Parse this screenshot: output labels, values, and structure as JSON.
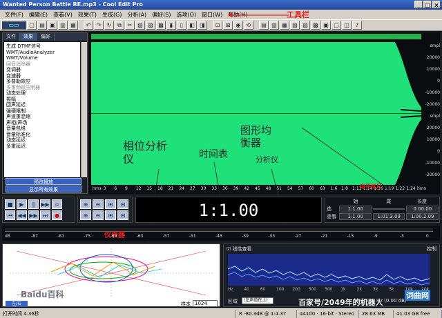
{
  "window": {
    "title": "Wanted Person Battle RE.mp3 - Cool Edit Pro",
    "controls": [
      "_",
      "□",
      "×"
    ]
  },
  "menu": {
    "items": [
      "文件(F)",
      "编辑(E)",
      "查看(V)",
      "效果(T)",
      "生成(G)",
      "分析(A)",
      "偏好(S)",
      "选项(O)",
      "窗口(W)",
      "帮助(H)"
    ],
    "annotation": "工具栏"
  },
  "left_panel": {
    "tabs": [
      "文件",
      "效果",
      "偏好"
    ],
    "active_tab": 1,
    "effects": [
      {
        "label": "生成 DTMF信号",
        "dim": false
      },
      {
        "label": "WMT/AudioAnalyzer",
        "dim": false
      },
      {
        "label": "WMT/Volume",
        "dim": false
      },
      {
        "label": "回音消除器",
        "dim": true
      },
      {
        "label": "变调器",
        "dim": false
      },
      {
        "label": "变速器",
        "dim": false
      },
      {
        "label": "多普勒效应",
        "dim": false
      },
      {
        "label": "多重频段压制器",
        "dim": true
      },
      {
        "label": "动态处理",
        "dim": false
      },
      {
        "label": "振幅",
        "dim": false
      },
      {
        "label": "回声延迟",
        "dim": false
      },
      {
        "label": "强硬限制",
        "dim": false
      },
      {
        "label": "声道重混缩",
        "dim": false
      },
      {
        "label": "声相/声场",
        "dim": false
      },
      {
        "label": "音量包络",
        "dim": false
      },
      {
        "label": "音量标准化",
        "dim": false
      },
      {
        "label": "动态延迟",
        "dim": false
      },
      {
        "label": "多重延迟",
        "dim": false
      }
    ],
    "button_1": "预览播放",
    "button_2": "显示所有效果"
  },
  "wave": {
    "scale_labels": [
      "smpl",
      "20000",
      "10000",
      "0",
      "-10000",
      "-20000",
      "smpl",
      "20000",
      "10000",
      "0",
      "-10000",
      "-20000"
    ],
    "ruler_labels": [
      "hms",
      "3",
      "6",
      "9",
      "12",
      "15",
      "18",
      "21",
      "24",
      "27",
      "30",
      "33",
      "36",
      "39",
      "42",
      "45",
      "48",
      "51",
      "54",
      "57",
      "60",
      "63",
      "1:6",
      "1:8",
      "1:11",
      "1:14",
      "1:16",
      "1:19",
      "1:22",
      "1:24",
      "hms"
    ],
    "annotation": "电平标尺"
  },
  "annotations": {
    "phase": "相位分析\n仪",
    "time": "时间表",
    "equalizer": "图形均\n衡器",
    "analyzer": "分析仪",
    "meter": "仪表器"
  },
  "transport": {
    "buttons": [
      "■",
      "▶",
      "‖",
      "▶▶",
      "∞",
      "⏮",
      "◀◀",
      "▶▶",
      "⏭",
      "●"
    ]
  },
  "zoom": {
    "buttons": [
      "⊕",
      "⊖",
      "⊞",
      "⊟",
      "⊕",
      "⊖",
      "⊞",
      "⊟"
    ]
  },
  "time_display": "1:1.00",
  "range": {
    "headers": [
      "始",
      "尾",
      "长度"
    ],
    "sel_label": "选",
    "view_label": "查看",
    "sel": [
      "1:1.00",
      "",
      "0:00.00"
    ],
    "view": [
      "1:1.00",
      "1:01.3.09",
      "1:00.2.09"
    ]
  },
  "level_meter": {
    "labels": [
      "dB",
      "-87",
      "-81",
      "-75",
      "-69",
      "-63",
      "-57",
      "-51",
      "-45",
      "-39",
      "-33",
      "-27",
      "-21",
      "-15",
      "-9",
      "-3",
      "0"
    ]
  },
  "phase": {
    "button": "左/右",
    "sample_label": "样本",
    "sample_value": "1024"
  },
  "spectrum": {
    "checkbox_label": "线性查看",
    "control_label": "控制",
    "freq_labels": [
      "Hz",
      "40",
      "60",
      "100",
      "200",
      "300",
      "500",
      "1k",
      "2k",
      "3k",
      "5k",
      "10k",
      "20k"
    ],
    "region_label": "区域",
    "region_value": "(左声道在上)",
    "readout": "L = 23.592 Hz (0.00 dB)"
  },
  "status": {
    "cells": [
      "打开时间 4.36秒",
      "R -80.3dB @ 1:4.37",
      "44100 · 16-bit · Stereo",
      "28.63 MB",
      "41.03 GB free"
    ]
  },
  "watermarks": {
    "baidu": "Baidu百科",
    "baijiahao": "百家号/2049年的机器人",
    "site": "词曲网"
  },
  "colors": {
    "wave": "#1fe17a",
    "accent": "#3a63c0",
    "annotation_red": "#e8201c"
  }
}
